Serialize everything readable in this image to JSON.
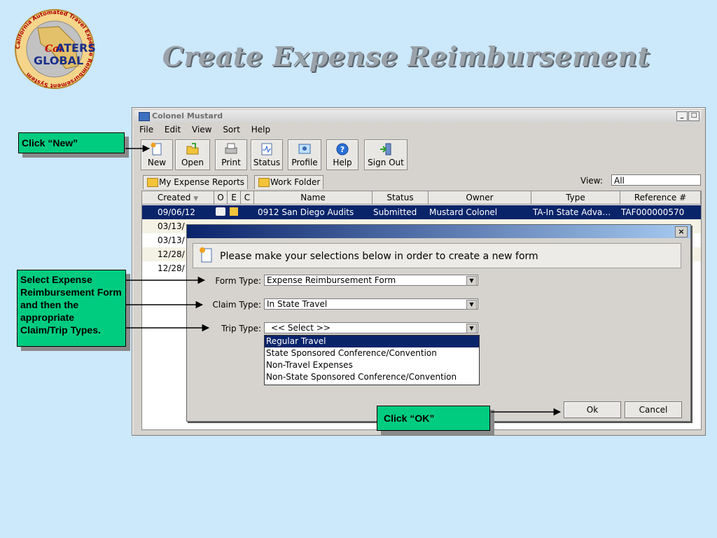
{
  "slide": {
    "title": "Create Expense Reimbursement"
  },
  "logo": {
    "arc_text": "California Automated Travel Expense Reimbursement System",
    "line1": "ATERS",
    "line2": "GLOBAL",
    "cal": "Cal"
  },
  "window": {
    "title": "Colonel Mustard",
    "menu": [
      "File",
      "Edit",
      "View",
      "Sort",
      "Help"
    ],
    "toolbar": [
      {
        "label": "New",
        "icon": "new-doc-icon"
      },
      {
        "label": "Open",
        "icon": "open-folder-icon"
      },
      {
        "label": "Print",
        "icon": "printer-icon"
      },
      {
        "label": "Status",
        "icon": "status-icon"
      },
      {
        "label": "Profile",
        "icon": "profile-icon"
      },
      {
        "label": "Help",
        "icon": "help-icon"
      },
      {
        "label": "Sign Out",
        "icon": "sign-out-icon"
      }
    ],
    "tabs": [
      {
        "label": "My Expense Reports",
        "icon": "folder-icon"
      },
      {
        "label": "Work Folder",
        "icon": "folder-icon"
      }
    ],
    "view": {
      "label": "View:",
      "value": "All"
    },
    "columns": [
      "Created",
      "O",
      "E",
      "C",
      "Name",
      "Status",
      "Owner",
      "Type",
      "Reference #"
    ],
    "rows": [
      {
        "created": "09/06/12",
        "name": "0912 San Diego Audits",
        "status": "Submitted",
        "owner": "Mustard Colonel",
        "type": "TA-In State Adva…",
        "ref": "TAF000000570"
      },
      {
        "created": "03/13/",
        "name": "",
        "status": "",
        "owner": "",
        "type": "",
        "ref": ""
      },
      {
        "created": "03/13/",
        "name": "",
        "status": "",
        "owner": "",
        "type": "",
        "ref": ""
      },
      {
        "created": "12/28/",
        "name": "",
        "status": "",
        "owner": "",
        "type": "",
        "ref": ""
      },
      {
        "created": "12/28/",
        "name": "",
        "status": "",
        "owner": "",
        "type": "",
        "ref": ""
      }
    ]
  },
  "dialog": {
    "header": "Please make your selections below in order to create a new form",
    "close": "×",
    "form_type_label": "Form Type:",
    "form_type_value": "Expense Reimbursement Form",
    "claim_type_label": "Claim Type:",
    "claim_type_value": "In State Travel",
    "trip_type_label": "Trip Type:",
    "trip_type_value": "<< Select >>",
    "trip_options": [
      "Regular Travel",
      "State Sponsored Conference/Convention",
      "Non-Travel Expenses",
      "Non-State Sponsored Conference/Convention"
    ],
    "ok": "Ok",
    "cancel": "Cancel"
  },
  "callouts": {
    "new": "Click  “New”",
    "select": "Select Expense Reimbursement Form and then the appropriate Claim/Trip Types.",
    "ok": "Click  “OK”"
  },
  "colors": {
    "background": "#cce8fb",
    "callout": "#00cc80",
    "selection": "#0a246a"
  }
}
